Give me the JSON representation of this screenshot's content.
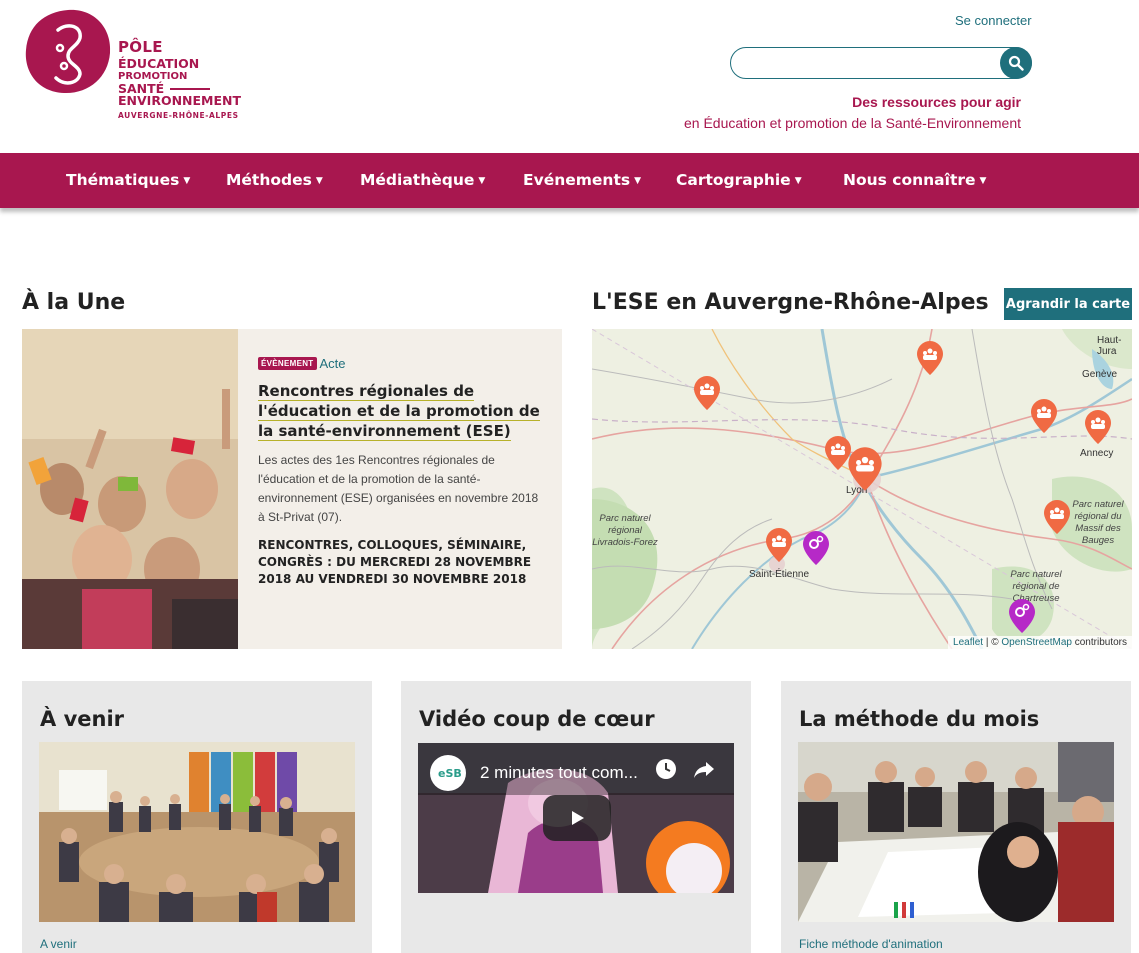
{
  "header": {
    "logo": {
      "line1": "PÔLE",
      "line2": "ÉDUCATION",
      "line3": "PROMOTION",
      "line4": "SANTÉ",
      "line5": "ENVIRONNEMENT",
      "line6": "AUVERGNE-RHÔNE-ALPES"
    },
    "connect_label": "Se connecter",
    "search": {
      "placeholder": ""
    },
    "tagline_bold": "Des ressources pour agir",
    "tagline": "en Éducation et promotion de la Santé-Environnement"
  },
  "nav": {
    "items": [
      {
        "label": "Thématiques"
      },
      {
        "label": "Méthodes"
      },
      {
        "label": "Médiathèque"
      },
      {
        "label": "Evénements"
      },
      {
        "label": "Cartographie"
      },
      {
        "label": "Nous connaître"
      }
    ],
    "caret": "▼"
  },
  "une": {
    "title": "À la Une",
    "badge": "ÉVÈNEMENT",
    "category": "Acte",
    "article_title": "Rencontres régionales de l'éducation et de la promotion de la santé-environnement (ESE)",
    "description": "Les actes des 1es Rencontres régionales de l'éducation et de la promotion de la santé-environnement (ESE) organisées en novembre 2018 à St-Privat (07).",
    "dates": "RENCONTRES, COLLOQUES, SÉMINAIRE, CONGRÈS : DU MERCREDI 28 NOVEMBRE 2018 AU VENDREDI 30 NOVEMBRE 2018"
  },
  "map": {
    "title": "L'ESE en Auvergne-Rhône-Alpes",
    "enlarge_button": "Agrandir la carte",
    "labels": {
      "parc1": "Parc naturel régional Livradois-Forez",
      "parc2": "Parc naturel régional du Massif des Bauges",
      "parc3": "Parc naturel régional de Chartreuse",
      "haut_jura": "Haut-Jura",
      "geneve": "Genève",
      "annecy": "Annecy",
      "lyon": "Lyon",
      "saint_etienne": "Saint-Étienne"
    },
    "attribution": {
      "leaflet": "Leaflet",
      "sep": "| ©",
      "osm": "OpenStreetMap",
      "contributors": "contributors"
    },
    "marker_colors": {
      "event": "#f06a43",
      "method": "#b629c7"
    }
  },
  "cards": [
    {
      "title": "À venir",
      "link": "A venir"
    },
    {
      "title": "Vidéo coup de cœur",
      "video_title": "2 minutes tout com...",
      "link": ""
    },
    {
      "title": "La méthode du mois",
      "link": "Fiche méthode d'animation"
    }
  ],
  "colors": {
    "brand": "#a8174f",
    "accent": "#1f6f7c"
  }
}
